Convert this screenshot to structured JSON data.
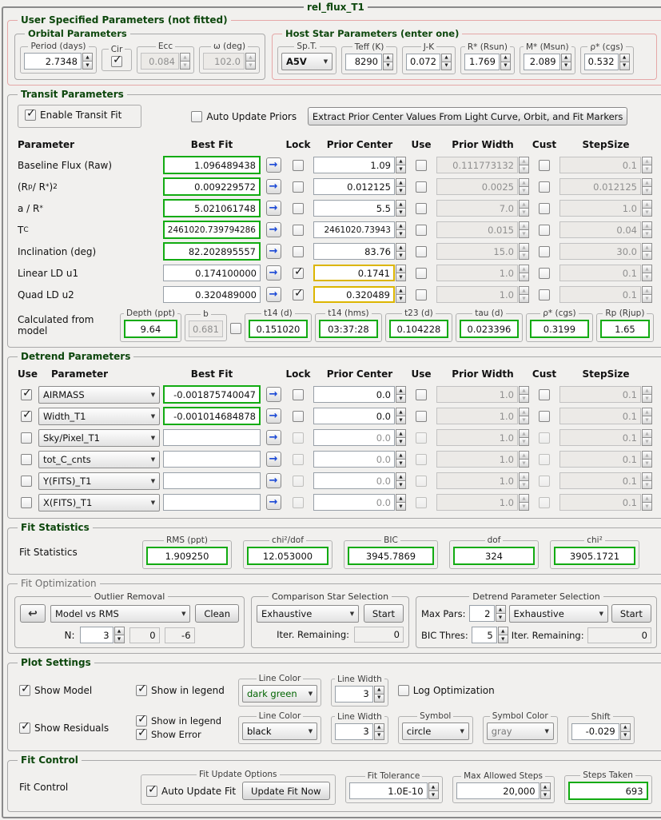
{
  "window": {
    "title": "rel_flux_T1"
  },
  "icons": {
    "spinner_up": "▲",
    "spinner_down": "▼",
    "dropdown_arrow": "▼",
    "copy_arrow": "→",
    "undo_arrow": "↩",
    "checkmark": "✓"
  },
  "colors": {
    "fitted_value_green": "#12ab12",
    "locked_prior_yellow": "#dcb501",
    "copy_arrow_blue": "#1b49d6",
    "section_title_green": "#0d470d",
    "user_group_pink": "#e5a7a7"
  },
  "user_params": {
    "title": "User Specified Parameters (not fitted)",
    "orbital": {
      "title": "Orbital Parameters",
      "period_label": "Period (days)",
      "period": "2.7348",
      "cir_label": "Cir",
      "cir_checked": true,
      "ecc_label": "Ecc",
      "ecc": "0.084",
      "omega_label": "ω (deg)",
      "omega": "102.0"
    },
    "host_star": {
      "title": "Host Star Parameters (enter one)",
      "spt_label": "Sp.T.",
      "spt": "A5V",
      "teff_label": "Teff (K)",
      "teff": "8290",
      "jk_label": "J-K",
      "jk": "0.072",
      "rstar_label": "R* (Rsun)",
      "rstar": "1.769",
      "mstar_label": "M* (Msun)",
      "mstar": "2.089",
      "rho_label": "ρ* (cgs)",
      "rho": "0.532"
    }
  },
  "transit": {
    "title": "Transit Parameters",
    "enable_fit_label": "Enable Transit Fit",
    "enable_fit_checked": true,
    "auto_update_label": "Auto Update Priors",
    "auto_update_checked": false,
    "extract_button": "Extract Prior Center Values From Light Curve, Orbit, and Fit Markers",
    "headers": {
      "parameter": "Parameter",
      "best_fit": "Best Fit",
      "lock": "Lock",
      "prior_center": "Prior Center",
      "use": "Use",
      "prior_width": "Prior Width",
      "cust": "Cust",
      "stepsize": "StepSize"
    },
    "rows": [
      {
        "label": "Baseline Flux (Raw)",
        "best_fit": "1.096489438",
        "lock": false,
        "prior_center": "1.09",
        "use": false,
        "prior_width": "0.111773132",
        "cust": false,
        "stepsize": "0.1"
      },
      {
        "label": "(R<sub>p</sub> / R<sub>*</sub>)<sup>2</sup>",
        "best_fit": "0.009229572",
        "lock": false,
        "prior_center": "0.012125",
        "use": false,
        "prior_width": "0.0025",
        "cust": false,
        "stepsize": "0.012125"
      },
      {
        "label": "a / R<sub>*</sub>",
        "best_fit": "5.021061748",
        "lock": false,
        "prior_center": "5.5",
        "use": false,
        "prior_width": "7.0",
        "cust": false,
        "stepsize": "1.0"
      },
      {
        "label": "T<sub>C</sub>",
        "best_fit": "2461020.739794286",
        "lock": false,
        "prior_center": "2461020.73943",
        "use": false,
        "prior_width": "0.015",
        "cust": false,
        "stepsize": "0.04"
      },
      {
        "label": "Inclination (deg)",
        "best_fit": "82.202895557",
        "lock": false,
        "prior_center": "83.76",
        "use": false,
        "prior_width": "15.0",
        "cust": false,
        "stepsize": "30.0"
      },
      {
        "label": "Linear LD u1",
        "best_fit": "0.174100000",
        "lock": true,
        "prior_center": "0.1741",
        "use": false,
        "prior_width": "1.0",
        "cust": false,
        "stepsize": "0.1"
      },
      {
        "label": "Quad LD u2",
        "best_fit": "0.320489000",
        "lock": true,
        "prior_center": "0.320489",
        "use": false,
        "prior_width": "1.0",
        "cust": false,
        "stepsize": "0.1"
      }
    ],
    "calculated": {
      "label": "Calculated from model",
      "depth": {
        "title": "Depth (ppt)",
        "value": "9.64"
      },
      "b": {
        "title": "b",
        "value": "0.681"
      },
      "b_checked": false,
      "t14d": {
        "title": "t14 (d)",
        "value": "0.151020"
      },
      "t14hms": {
        "title": "t14 (hms)",
        "value": "03:37:28"
      },
      "t23d": {
        "title": "t23 (d)",
        "value": "0.104228"
      },
      "tau": {
        "title": "tau (d)",
        "value": "0.023396"
      },
      "rho": {
        "title": "ρ* (cgs)",
        "value": "0.3199"
      },
      "rp": {
        "title": "Rp (Rjup)",
        "value": "1.65"
      }
    }
  },
  "detrend": {
    "title": "Detrend Parameters",
    "headers": {
      "use": "Use",
      "parameter": "Parameter",
      "best_fit": "Best Fit",
      "lock": "Lock",
      "prior_center": "Prior Center",
      "use2": "Use",
      "prior_width": "Prior Width",
      "cust": "Cust",
      "stepsize": "StepSize"
    },
    "rows": [
      {
        "use": true,
        "param": "AIRMASS",
        "best_fit": "-0.001875740047",
        "lock": false,
        "prior_center": "0.0",
        "use2": false,
        "prior_width": "1.0",
        "cust": false,
        "stepsize": "0.1"
      },
      {
        "use": true,
        "param": "Width_T1",
        "best_fit": "-0.001014684878",
        "lock": false,
        "prior_center": "0.0",
        "use2": false,
        "prior_width": "1.0",
        "cust": false,
        "stepsize": "0.1"
      },
      {
        "use": false,
        "param": "Sky/Pixel_T1",
        "best_fit": "",
        "lock": false,
        "prior_center": "0.0",
        "use2": false,
        "prior_width": "1.0",
        "cust": false,
        "stepsize": "0.1"
      },
      {
        "use": false,
        "param": "tot_C_cnts",
        "best_fit": "",
        "lock": false,
        "prior_center": "0.0",
        "use2": false,
        "prior_width": "1.0",
        "cust": false,
        "stepsize": "0.1"
      },
      {
        "use": false,
        "param": "Y(FITS)_T1",
        "best_fit": "",
        "lock": false,
        "prior_center": "0.0",
        "use2": false,
        "prior_width": "1.0",
        "cust": false,
        "stepsize": "0.1"
      },
      {
        "use": false,
        "param": "X(FITS)_T1",
        "best_fit": "",
        "lock": false,
        "prior_center": "0.0",
        "use2": false,
        "prior_width": "1.0",
        "cust": false,
        "stepsize": "0.1"
      }
    ]
  },
  "fit_statistics": {
    "title": "Fit Statistics",
    "label": "Fit Statistics",
    "rms": {
      "title": "RMS (ppt)",
      "value": "1.909250"
    },
    "chi2dof": {
      "title": "chi²/dof",
      "value": "12.053000"
    },
    "bic": {
      "title": "BIC",
      "value": "3945.7869"
    },
    "dof": {
      "title": "dof",
      "value": "324"
    },
    "chi2": {
      "title": "chi²",
      "value": "3905.1721"
    }
  },
  "fit_optimization": {
    "title": "Fit Optimization",
    "outlier": {
      "title": "Outlier Removal",
      "method": "Model vs RMS",
      "clean_button": "Clean",
      "n_label": "N:",
      "n": "3",
      "removed": "0",
      "delta": "-6"
    },
    "comp_star": {
      "title": "Comparison Star Selection",
      "method": "Exhaustive",
      "start_button": "Start",
      "iter_label": "Iter. Remaining:",
      "iter": "0"
    },
    "detrend_sel": {
      "title": "Detrend Parameter Selection",
      "max_label": "Max Pars:",
      "max_pars": "2",
      "method": "Exhaustive",
      "start_button": "Start",
      "bic_label": "BIC Thres:",
      "bic_thres": "5",
      "iter_label": "Iter. Remaining:",
      "iter": "0"
    }
  },
  "plot_settings": {
    "title": "Plot Settings",
    "show_model": "Show Model",
    "show_model_checked": true,
    "model_legend": "Show in legend",
    "model_legend_checked": true,
    "model_line_color": {
      "title": "Line Color",
      "value": "dark green",
      "color": "#006400"
    },
    "model_line_width": {
      "title": "Line Width",
      "value": "3"
    },
    "log_opt": "Log Optimization",
    "log_opt_checked": false,
    "show_residuals": "Show Residuals",
    "show_residuals_checked": true,
    "res_legend": "Show in legend",
    "res_legend_checked": true,
    "show_error": "Show Error",
    "show_error_checked": true,
    "res_line_color": {
      "title": "Line Color",
      "value": "black",
      "color": "#000000"
    },
    "res_line_width": {
      "title": "Line Width",
      "value": "3"
    },
    "symbol": {
      "title": "Symbol",
      "value": "circle"
    },
    "symbol_color": {
      "title": "Symbol Color",
      "value": "gray",
      "color": "#787878"
    },
    "shift": {
      "title": "Shift",
      "value": "-0.029"
    }
  },
  "fit_control": {
    "title": "Fit Control",
    "label": "Fit Control",
    "update_options": {
      "title": "Fit Update Options",
      "auto_label": "Auto Update Fit",
      "auto_checked": true,
      "button": "Update Fit Now"
    },
    "tolerance": {
      "title": "Fit Tolerance",
      "value": "1.0E-10"
    },
    "max_steps": {
      "title": "Max Allowed Steps",
      "value": "20,000"
    },
    "steps_taken": {
      "title": "Steps Taken",
      "value": "693"
    }
  }
}
